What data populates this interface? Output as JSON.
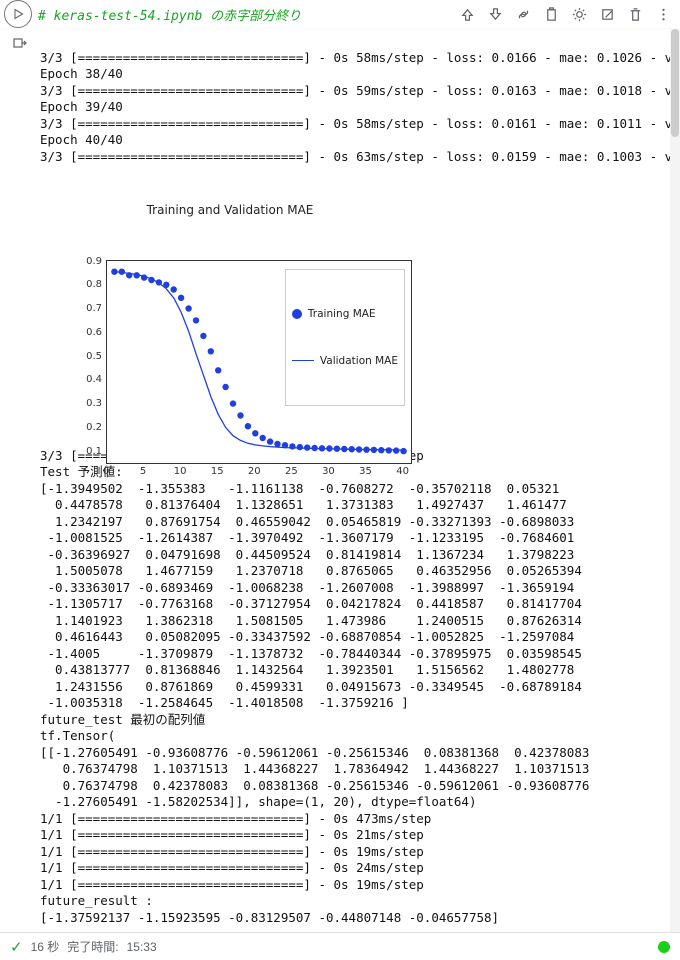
{
  "comment_line": "# keras-test-54.ipynb の赤字部分終り",
  "toolbar_icons": [
    "arrow-up",
    "arrow-down",
    "link",
    "clipboard",
    "gear",
    "target",
    "delete",
    "more"
  ],
  "chart_data": {
    "type": "mixed",
    "title": "Training and Validation MAE",
    "xlabel": "",
    "ylabel": "",
    "xlim": [
      0,
      41
    ],
    "ylim": [
      0.05,
      0.9
    ],
    "xticks": [
      0,
      5,
      10,
      15,
      20,
      25,
      30,
      35,
      40
    ],
    "yticks": [
      0.1,
      0.2,
      0.3,
      0.4,
      0.5,
      0.6,
      0.7,
      0.8,
      0.9
    ],
    "legend_position": "upper-right",
    "series": [
      {
        "name": "Training MAE",
        "style": "scatter",
        "x": [
          1,
          2,
          3,
          4,
          5,
          6,
          7,
          8,
          9,
          10,
          11,
          12,
          13,
          14,
          15,
          16,
          17,
          18,
          19,
          20,
          21,
          22,
          23,
          24,
          25,
          26,
          27,
          28,
          29,
          30,
          31,
          32,
          33,
          34,
          35,
          36,
          37,
          38,
          39,
          40
        ],
        "y": [
          0.855,
          0.855,
          0.84,
          0.84,
          0.83,
          0.82,
          0.81,
          0.8,
          0.78,
          0.745,
          0.7,
          0.65,
          0.585,
          0.52,
          0.44,
          0.37,
          0.3,
          0.25,
          0.205,
          0.175,
          0.155,
          0.14,
          0.13,
          0.125,
          0.12,
          0.117,
          0.115,
          0.113,
          0.112,
          0.111,
          0.11,
          0.109,
          0.108,
          0.107,
          0.106,
          0.105,
          0.104,
          0.103,
          0.102,
          0.1
        ]
      },
      {
        "name": "Validation MAE",
        "style": "line",
        "x": [
          1,
          2,
          3,
          4,
          5,
          6,
          7,
          8,
          9,
          10,
          11,
          12,
          13,
          14,
          15,
          16,
          17,
          18,
          19,
          20,
          21,
          22,
          23,
          24,
          25,
          26,
          27,
          28,
          29,
          30,
          31,
          32,
          33,
          34,
          35,
          36,
          37,
          38,
          39,
          40
        ],
        "y": [
          0.855,
          0.852,
          0.848,
          0.843,
          0.836,
          0.825,
          0.808,
          0.783,
          0.745,
          0.685,
          0.605,
          0.51,
          0.42,
          0.33,
          0.255,
          0.2,
          0.165,
          0.145,
          0.133,
          0.126,
          0.122,
          0.119,
          0.117,
          0.115,
          0.114,
          0.113,
          0.112,
          0.111,
          0.11,
          0.11,
          0.109,
          0.108,
          0.108,
          0.107,
          0.107,
          0.106,
          0.106,
          0.105,
          0.105,
          0.104
        ]
      }
    ]
  },
  "pre_chart_text": "3/3 [==============================] - 0s 58ms/step - loss: 0.0166 - mae: 0.1026 - val_lo\nEpoch 38/40\n3/3 [==============================] - 0s 59ms/step - loss: 0.0163 - mae: 0.1018 - val_lo\nEpoch 39/40\n3/3 [==============================] - 0s 58ms/step - loss: 0.0161 - mae: 0.1011 - val_lo\nEpoch 40/40\n3/3 [==============================] - 0s 63ms/step - loss: 0.0159 - mae: 0.1003 - val_lo",
  "post_chart_text": "3/3 [==============================] - 1s 10ms/step\nTest 予測値:\n[-1.3949502  -1.355383   -1.1161138  -0.7608272  -0.35702118  0.05321\n  0.4478578   0.81376404  1.1328651   1.3731383   1.4927437   1.461477\n  1.2342197   0.87691754  0.46559042  0.05465819 -0.33271393 -0.6898033\n -1.0081525  -1.2614387  -1.3970492  -1.3607179  -1.1233195  -0.7684601\n -0.36396927  0.04791698  0.44509524  0.81419814  1.1367234   1.3798223\n  1.5005078   1.4677159   1.2370718   0.8765065   0.46352956  0.05265394\n -0.33363017 -0.6893469  -1.0068238  -1.2607008  -1.3988997  -1.3659194\n -1.1305717  -0.7763168  -0.37127954  0.04217824  0.4418587   0.81417704\n  1.1401923   1.3862318   1.5081505   1.473986    1.2400515   0.87626314\n  0.4616443   0.05082095 -0.33437592 -0.68870854 -1.0052825  -1.2597084\n -1.4005     -1.3709879  -1.1378732  -0.78440344 -0.37895975  0.03598545\n  0.43813777  0.81368846  1.1432564   1.3923501   1.5156562   1.4802778\n  1.2431556   0.8761869   0.4599331   0.04915673 -0.3349545  -0.68789184\n -1.0035318  -1.2584645  -1.4018508  -1.3759216 ]\nfuture_test 最初の配列値\ntf.Tensor(\n[[-1.27605491 -0.93608776 -0.59612061 -0.25615346  0.08381368  0.42378083\n   0.76374798  1.10371513  1.44368227  1.78364942  1.44368227  1.10371513\n   0.76374798  0.42378083  0.08381368 -0.25615346 -0.59612061 -0.93608776\n  -1.27605491 -1.58202534]], shape=(1, 20), dtype=float64)\n1/1 [==============================] - 0s 473ms/step\n1/1 [==============================] - 0s 21ms/step\n1/1 [==============================] - 0s 19ms/step\n1/1 [==============================] - 0s 24ms/step\n1/1 [==============================] - 0s 19ms/step\nfuture_result :\n[-1.37592137 -1.15923595 -0.83129507 -0.44807148 -0.04657758]",
  "status": {
    "check_icon": "✓",
    "elapsed": "16 秒",
    "completed_label": "完了時間:",
    "completed_time": "15:33"
  }
}
